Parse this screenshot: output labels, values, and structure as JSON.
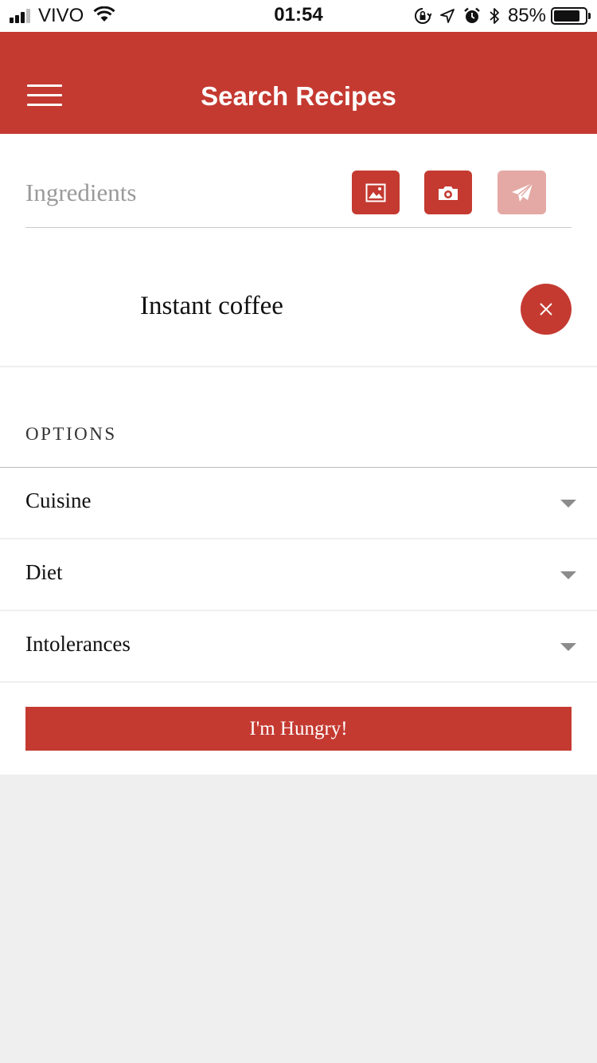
{
  "status_bar": {
    "carrier": "VIVO",
    "time": "01:54",
    "battery_percent_text": "85%",
    "battery_level": 0.85,
    "icons": [
      "signal-icon",
      "wifi-icon",
      "orientation-lock-icon",
      "location-icon",
      "alarm-icon",
      "bluetooth-icon",
      "battery-icon"
    ]
  },
  "app_bar": {
    "title": "Search Recipes",
    "menu_icon": "hamburger-menu-icon"
  },
  "search": {
    "placeholder": "Ingredients",
    "value": "",
    "buttons": [
      {
        "icon": "gallery-icon",
        "state": "enabled"
      },
      {
        "icon": "camera-icon",
        "state": "enabled"
      },
      {
        "icon": "send-icon",
        "state": "disabled"
      }
    ]
  },
  "ingredients": [
    {
      "name": "Instant coffee",
      "remove_icon": "close-icon"
    }
  ],
  "options": {
    "heading": "OPTIONS",
    "items": [
      {
        "label": "Cuisine"
      },
      {
        "label": "Diet"
      },
      {
        "label": "Intolerances"
      }
    ]
  },
  "submit": {
    "label": "I'm Hungry!"
  },
  "colors": {
    "primary": "#c43a31",
    "primary_disabled": "#e4a9a5",
    "background": "#efefef",
    "surface": "#ffffff"
  }
}
